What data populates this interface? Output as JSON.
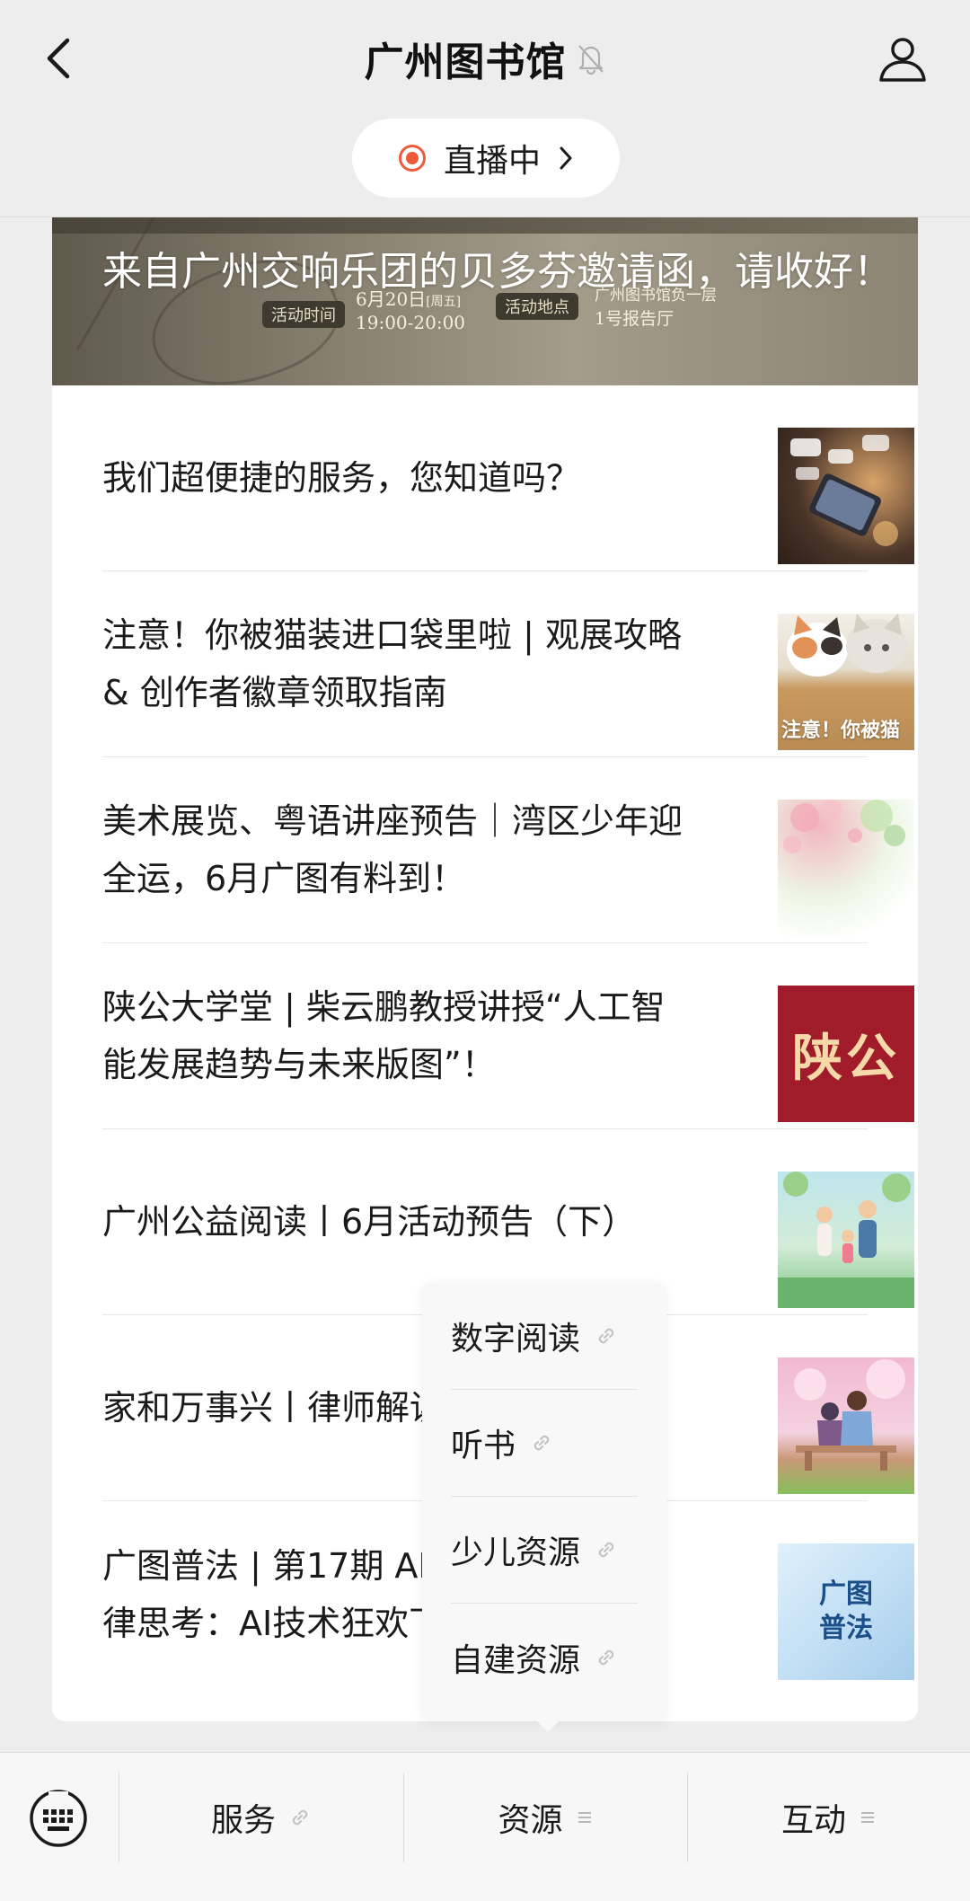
{
  "header": {
    "title": "广州图书馆",
    "live_label": "直播中"
  },
  "banner": {
    "time_tag": "活动时间",
    "date": "6月20日",
    "weekday": "[周五]",
    "time": "19:00-20:00",
    "place_tag": "活动地点",
    "place_line1": "广州图书馆负一层",
    "place_line2": "1号报告厅",
    "title": "来自广州交响乐团的贝多芬邀请函，请收好！"
  },
  "articles": [
    {
      "title": "我们超便捷的服务，您知道吗？"
    },
    {
      "title": "注意！你被猫装进口袋里啦 | 观展攻略 & 创作者徽章领取指南",
      "thumb_caption": "注意！你被猫"
    },
    {
      "title": "美术展览、粤语讲座预告｜湾区少年迎全运，6月广图有料到！"
    },
    {
      "title": "陕公大学堂 | 柴云鹏教授讲授“人工智能发展趋势与未来版图”！",
      "thumb_text": "陕公"
    },
    {
      "title": "广州公益阅读丨6月活动预告（下）"
    },
    {
      "title": "家和万事兴丨律师解读家庭相处之道"
    },
    {
      "title": "广图普法 | 第17期 AI技术狂欢下的法律思考：AI技术狂欢下的法律",
      "thumb_text_1": "广图",
      "thumb_text_2": "普法"
    }
  ],
  "submenu": {
    "items": [
      {
        "label": "数字阅读"
      },
      {
        "label": "听书"
      },
      {
        "label": "少儿资源"
      },
      {
        "label": "自建资源"
      }
    ]
  },
  "menubar": {
    "tabs": [
      {
        "label": "服务",
        "icon": "link-icon"
      },
      {
        "label": "资源",
        "icon": "menu-lines-icon"
      },
      {
        "label": "互动",
        "icon": "menu-lines-icon"
      }
    ]
  },
  "colors": {
    "live_accent": "#f05a3c",
    "background": "#ededed"
  }
}
